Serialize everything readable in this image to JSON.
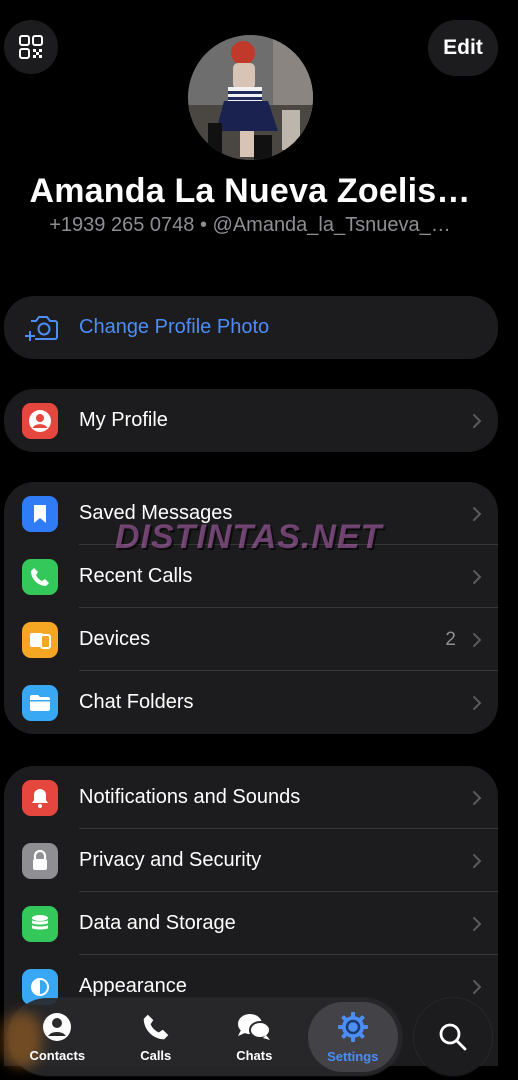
{
  "header": {
    "edit_label": "Edit",
    "name": "Amanda La Nueva Zoelis…",
    "subtitle": "+1939 265 0748 • @Amanda_la_Tsnueva_…"
  },
  "change_photo": {
    "label": "Change Profile Photo"
  },
  "my_profile": {
    "label": "My Profile"
  },
  "group1": {
    "items": [
      {
        "label": "Saved Messages",
        "icon": "bookmark-icon",
        "color": "#2f7cf6"
      },
      {
        "label": "Recent Calls",
        "icon": "phone-icon",
        "color": "#34c759"
      },
      {
        "label": "Devices",
        "icon": "devices-icon",
        "color": "#f5a623",
        "count": "2"
      },
      {
        "label": "Chat Folders",
        "icon": "folder-icon",
        "color": "#38a8f5"
      }
    ]
  },
  "group2": {
    "items": [
      {
        "label": "Notifications and Sounds",
        "icon": "bell-icon",
        "color": "#e5473f"
      },
      {
        "label": "Privacy and Security",
        "icon": "lock-icon",
        "color": "#8e8e93"
      },
      {
        "label": "Data and Storage",
        "icon": "database-icon",
        "color": "#34c759"
      },
      {
        "label": "Appearance",
        "icon": "appearance-icon",
        "color": "#38a8f5"
      }
    ]
  },
  "watermark": "DISTINTAS.NET",
  "tabbar": {
    "tabs": [
      {
        "label": "Contacts",
        "icon": "person-icon"
      },
      {
        "label": "Calls",
        "icon": "phone-icon"
      },
      {
        "label": "Chats",
        "icon": "chat-bubbles-icon"
      },
      {
        "label": "Settings",
        "icon": "gear-icon",
        "active": true
      }
    ]
  },
  "colors": {
    "accent": "#4c8df6",
    "background": "#000000",
    "card": "#1c1c1e",
    "secondary_text": "#8e8e93"
  }
}
